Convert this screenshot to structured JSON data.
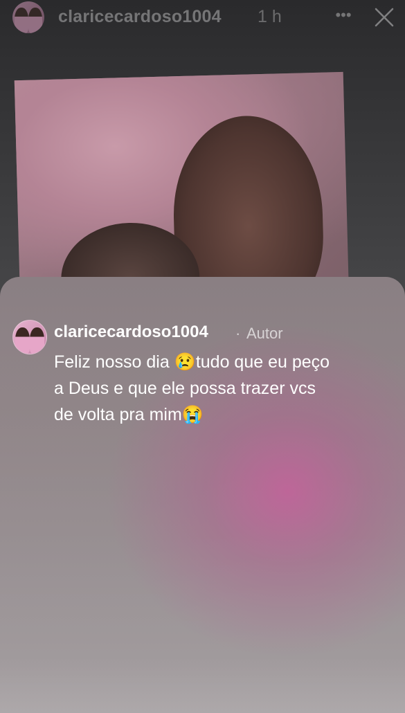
{
  "header": {
    "username": "claricecardoso1004",
    "time": "1 h",
    "more_icon": "ellipsis-icon",
    "close_icon": "close-icon"
  },
  "comment": {
    "author": "claricecardoso1004",
    "separator": "·",
    "badge": "Autor",
    "text": "Feliz nosso dia 😢tudo que eu peço a Deus e que ele possa trazer vcs de volta pra mim😭"
  },
  "colors": {
    "sheet_accent": "#be5f96",
    "background": "#3a3a3c"
  }
}
